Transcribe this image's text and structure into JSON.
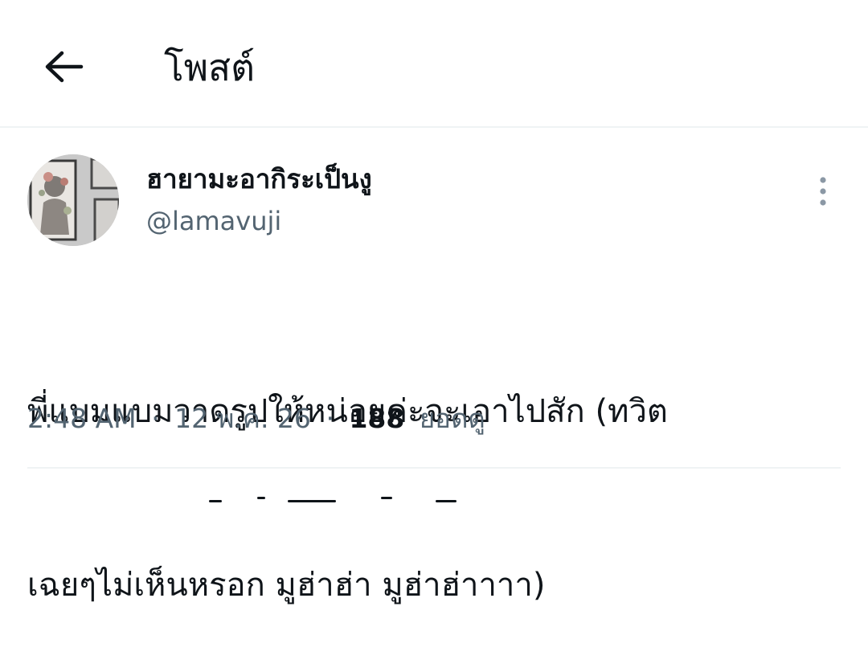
{
  "header": {
    "title": "โพสต์",
    "back_icon": "arrow-left-icon"
  },
  "post": {
    "display_name": "ฮายามะอากิระเป็นงู",
    "handle": "@lamavuji",
    "more_icon": "more-vertical-icon",
    "text_lines": [
      "พี่แบมแบมวาดรูปให้หน่อยค่ะจะเอาไปสัก (ทวิต",
      "เฉยๆไม่เห็นหรอก มูฮ่าฮ่า มูฮ่าฮ่าาาา)"
    ],
    "time": "2:48 AM",
    "separator": "·",
    "date": "12 พ.ค. 26",
    "views_count": "188",
    "views_label": "ยอดดู"
  },
  "colors": {
    "text_primary": "#0f1419",
    "text_secondary": "#536471",
    "divider": "#eff3f4",
    "background": "#ffffff"
  }
}
